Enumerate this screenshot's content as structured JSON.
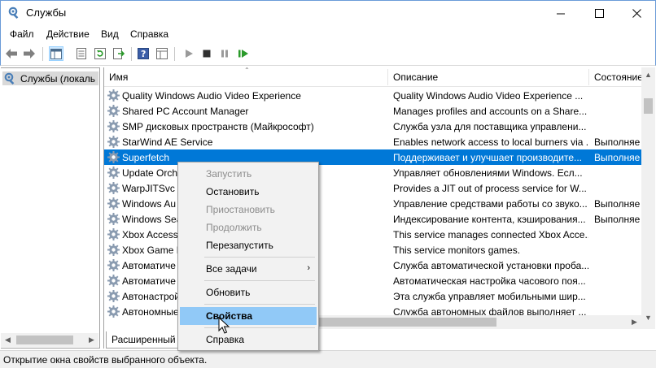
{
  "window": {
    "title": "Службы",
    "minimize_icon": "minimize-icon",
    "maximize_icon": "maximize-icon",
    "close_icon": "close-icon"
  },
  "menu": {
    "items": [
      "Файл",
      "Действие",
      "Вид",
      "Справка"
    ]
  },
  "toolbar": {
    "icons": [
      "back-arrow-icon",
      "forward-arrow-icon",
      "console-tree-icon",
      "properties-list-icon",
      "refresh-icon",
      "export-icon",
      "help-icon",
      "view-icon",
      "play-icon",
      "stop-icon",
      "pause-icon",
      "restart-icon"
    ]
  },
  "tree": {
    "root_label": "Службы (локаль"
  },
  "columns": {
    "name": "Имя",
    "description": "Описание",
    "status": "Состояние"
  },
  "services": [
    {
      "name": "Quality Windows Audio Video Experience",
      "description": "Quality Windows Audio Video Experience ...",
      "status": ""
    },
    {
      "name": "Shared PC Account Manager",
      "description": "Manages profiles and accounts on a Share...",
      "status": ""
    },
    {
      "name": "SMP дисковых пространств (Майкрософт)",
      "description": "Служба узла для поставщика управлени...",
      "status": ""
    },
    {
      "name": "StarWind AE Service",
      "description": "Enables network access to local burners via ...",
      "status": "Выполняе"
    },
    {
      "name": "Superfetch",
      "description": "Поддерживает и улучшает производите...",
      "status": "Выполняе",
      "selected": true
    },
    {
      "name": "Update Orch",
      "description": "Управляет обновлениями Windows. Есл...",
      "status": ""
    },
    {
      "name": "WarpJITSvc",
      "description": "Provides a JIT out of process service for W...",
      "status": ""
    },
    {
      "name": "Windows Au",
      "description": "Управление средствами работы со звуко...",
      "status": "Выполняе"
    },
    {
      "name": "Windows Sea",
      "description": "Индексирование контента, кэширования...",
      "status": "Выполняе"
    },
    {
      "name": "Xbox Access",
      "description": "This service manages connected Xbox Acce...",
      "status": ""
    },
    {
      "name": "Xbox Game M",
      "description": "This service monitors games.",
      "status": ""
    },
    {
      "name": "Автоматиче                                  в",
      "description": "Служба автоматической установки проба...",
      "status": ""
    },
    {
      "name": "Автоматиче                                 а",
      "description": "Автоматическая настройка часового поя...",
      "status": ""
    },
    {
      "name": "Автонастрой",
      "description": "Эта служба управляет мобильными шир...",
      "status": ""
    },
    {
      "name": "Автономные",
      "description": "Служба автономных файлов выполняет ...",
      "status": ""
    }
  ],
  "tabs": {
    "extended": "Расширенный"
  },
  "status_bar": {
    "text": "Открытие окна свойств выбранного объекта."
  },
  "context_menu": {
    "start": "Запустить",
    "stop": "Остановить",
    "pause": "Приостановить",
    "resume": "Продолжить",
    "restart": "Перезапустить",
    "all_tasks": "Все задачи",
    "refresh": "Обновить",
    "properties": "Свойства",
    "help": "Справка"
  },
  "colors": {
    "selection": "#0078d7",
    "menu_highlight": "#91c9f7",
    "window_border": "#6a9bd8"
  }
}
